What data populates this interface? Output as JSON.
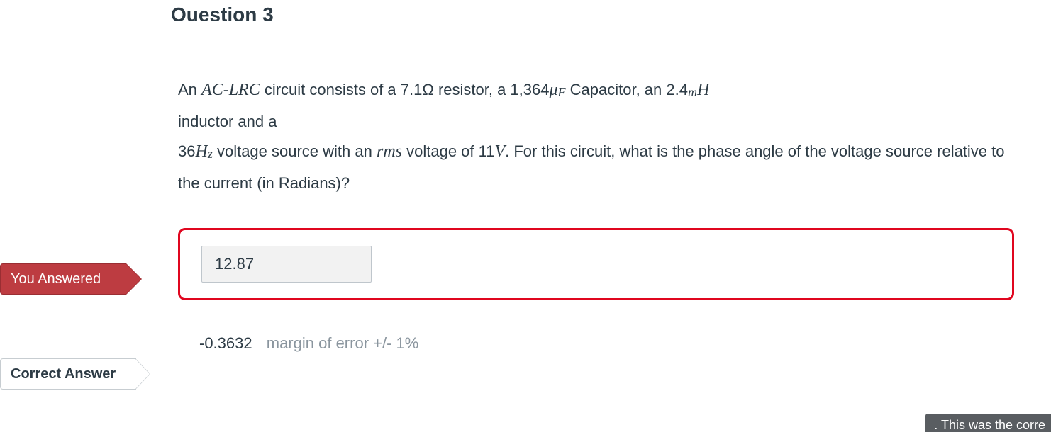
{
  "header": {
    "title": "Question 3"
  },
  "question": {
    "text1a": "An ",
    "ac_lrc_ac": "AC",
    "ac_lrc_dash": "-",
    "ac_lrc_lrc": "LRC",
    "text1b": " circuit consists of a  7.1",
    "omega": "Ω",
    "text1c": " resistor, a 1,364",
    "mu": "μ",
    "F": "F",
    "text1d": "  Capacitor, an 2.4",
    "m": "m",
    "H": "H",
    "text2a": " inductor and a",
    "text3a": "36",
    "Hz_H": "H",
    "Hz_z": "z",
    "text3b": " voltage source with an  ",
    "rms": "rms",
    "text3c": " voltage of  11",
    "V": "V",
    "text3d": ".  For this circuit, what is the phase angle of the voltage source relative to the current (in Radians)?"
  },
  "labels": {
    "you_answered": "You Answered",
    "correct_answer": "Correct Answer"
  },
  "answer": {
    "user_value": "12.87",
    "correct_value": "-0.3632",
    "margin_text": "margin of error +/- 1%"
  },
  "tooltip": {
    "text": ". This was the corre"
  }
}
